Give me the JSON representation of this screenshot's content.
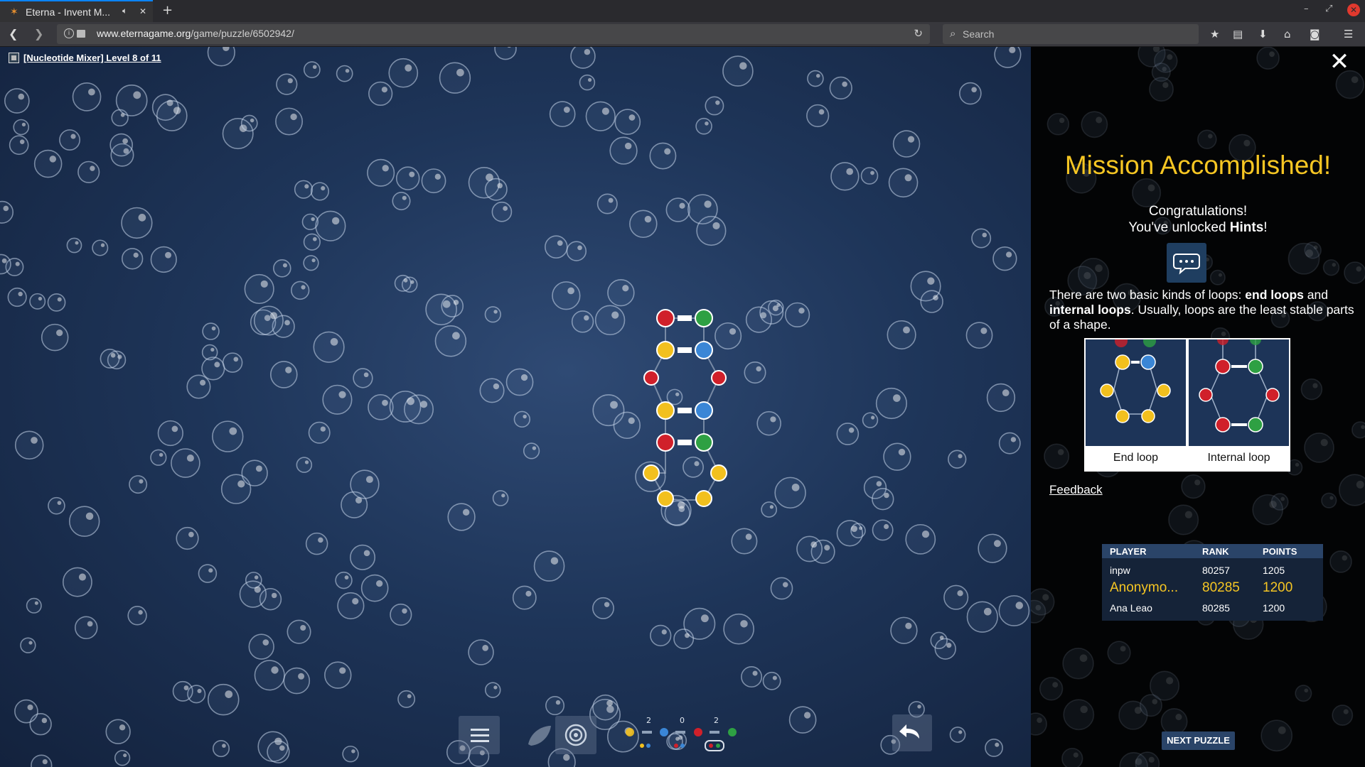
{
  "browser": {
    "tab_title": "Eterna - Invent M...",
    "url_host": "www.eternagame.org",
    "url_path": "/game/puzzle/6502942/",
    "search_placeholder": "Search"
  },
  "game": {
    "level_label": "[Nucleotide Mixer] Level 8 of 11",
    "pair_counts": [
      "2",
      "0",
      "2"
    ]
  },
  "panel": {
    "heading": "Mission Accomplished!",
    "congrats_line1": "Congratulations!",
    "congrats_line2_prefix": "You've unlocked ",
    "congrats_line2_bold": "Hints",
    "congrats_line2_suffix": "!",
    "loops_text": {
      "p1": "There are two basic kinds of loops: ",
      "b1": "end loops",
      "p2": " and ",
      "b2": "internal loops",
      "p3": ". Usually, loops are the least stable parts of a shape."
    },
    "figure_captions": [
      "End loop",
      "Internal loop"
    ],
    "feedback_label": "Feedback",
    "leaderboard": {
      "headers": [
        "PLAYER",
        "RANK",
        "POINTS"
      ],
      "rows": [
        {
          "player": "inpw",
          "rank": "80257",
          "points": "1205"
        },
        {
          "player": "Anonymo...",
          "rank": "80285",
          "points": "1200"
        },
        {
          "player": "Ana Leao",
          "rank": "80285",
          "points": "1200"
        }
      ]
    },
    "next_label": "NEXT PUZZLE"
  },
  "colors": {
    "accent_yellow": "#f6c623",
    "base_red": "#d0202a",
    "base_green": "#2ea043",
    "base_yellow": "#f2c01e",
    "base_blue": "#3a86d6"
  }
}
